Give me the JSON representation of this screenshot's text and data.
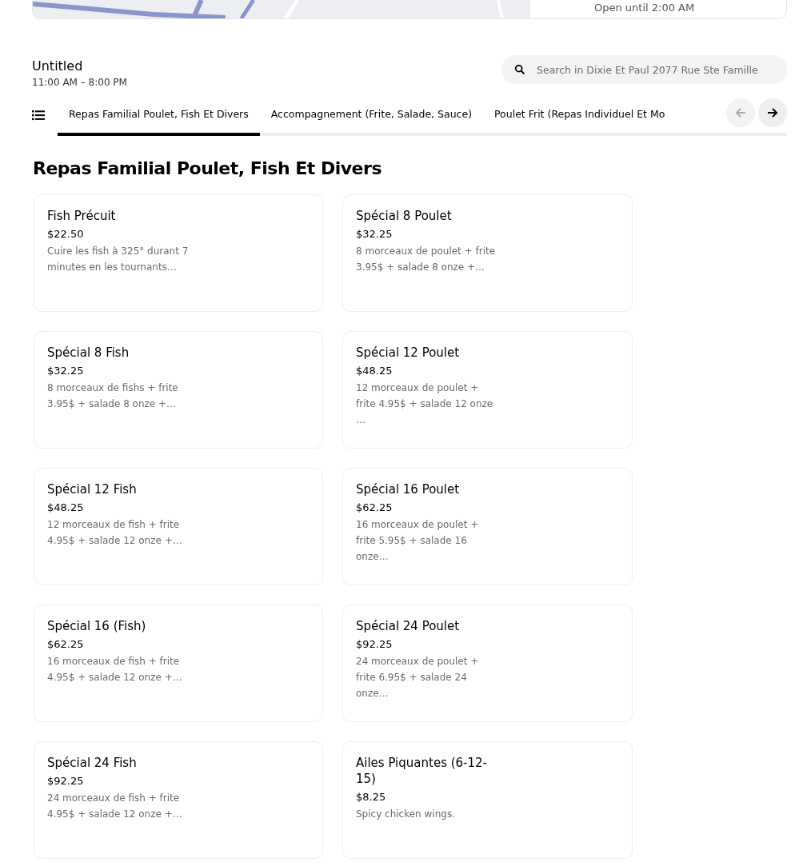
{
  "header": {
    "hours_panel": "Open until 2:00 AM"
  },
  "store": {
    "title": "Untitled",
    "hours": "11:00 AM – 8:00 PM"
  },
  "search": {
    "placeholder": "Search in Dixie Et Paul 2077 Rue Ste Famille"
  },
  "tabs": [
    {
      "label": "Repas Familial Poulet, Fish Et Divers",
      "selected": true
    },
    {
      "label": "Accompagnement (Frite, Salade, Sauce)",
      "selected": false
    },
    {
      "label": "Poulet Frit (Repas Individuel Et Mo",
      "selected": false
    }
  ],
  "tab_arrows": {
    "prev_disabled": true,
    "next_disabled": false
  },
  "section_title": "Repas Familial Poulet, Fish Et Divers",
  "items": [
    {
      "name": "Fish Précuit",
      "price": "$22.50",
      "description": "Cuire les fish à 325° durant 7 minutes en les tournants…"
    },
    {
      "name": "Spécial 8 Poulet",
      "price": "$32.25",
      "description": "8 morceaux de poulet + frite 3.95$ + salade 8 onze +…"
    },
    {
      "name": "Spécial 8 Fish",
      "price": "$32.25",
      "description": "8 morceaux de fishs + frite 3.95$ + salade 8 onze +…"
    },
    {
      "name": "Spécial 12 Poulet",
      "price": "$48.25",
      "description": "12 morceaux de poulet + frite 4.95$ + salade 12 onze …"
    },
    {
      "name": "Spécial 12 Fish",
      "price": "$48.25",
      "description": "12 morceaux de fish + frite 4.95$ + salade 12 onze +…"
    },
    {
      "name": "Spécial 16 Poulet",
      "price": "$62.25",
      "description": "16 morceaux de poulet + frite 5.95$ + salade 16 onze…"
    },
    {
      "name": "Spécial 16 (Fish)",
      "price": "$62.25",
      "description": "16 morceaux de fish + frite 4.95$ + salade 12 onze +…"
    },
    {
      "name": "Spécial 24 Poulet",
      "price": "$92.25",
      "description": "24 morceaux de poulet + frite 6.95$ + salade 24 onze…"
    },
    {
      "name": "Spécial 24 Fish",
      "price": "$92.25",
      "description": "24 morceaux de fish + frite 4.95$ + salade 12 onze +…"
    },
    {
      "name": "Ailes Piquantes (6-12-15)",
      "price": "$8.25",
      "description": "Spicy chicken wings."
    }
  ]
}
